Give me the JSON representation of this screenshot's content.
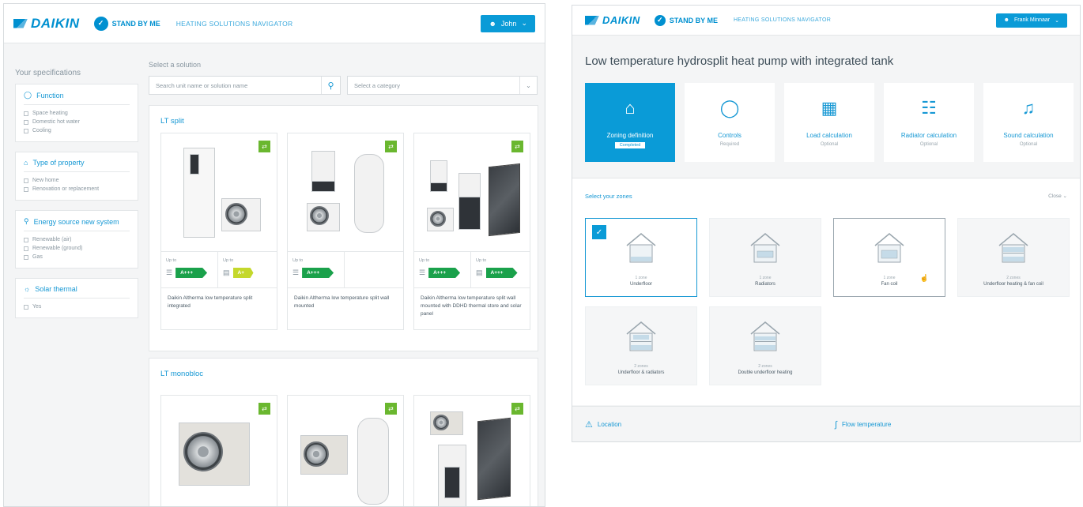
{
  "left": {
    "brand": "DAIKIN",
    "standby": "STAND BY ME",
    "app_name": "HEATING SOLUTIONS NAVIGATOR",
    "user": "John",
    "specs_title": "Your specifications",
    "filters": [
      {
        "title": "Function",
        "options": [
          "Space heating",
          "Domestic hot water",
          "Cooling"
        ]
      },
      {
        "title": "Type of property",
        "options": [
          "New home",
          "Renovation or replacement"
        ]
      },
      {
        "title": "Energy source new system",
        "options": [
          "Renewable (air)",
          "Renewable (ground)",
          "Gas"
        ]
      },
      {
        "title": "Solar thermal",
        "options": [
          "Yes"
        ]
      }
    ],
    "select_label": "Select a solution",
    "search_placeholder": "Search unit name or solution name",
    "category_placeholder": "Select a category",
    "groups": [
      {
        "title": "LT split",
        "cards": [
          {
            "up_to": "Up to",
            "ratings": [
              "A+++",
              "A+"
            ],
            "desc": "Daikin Altherma low temperature split integrated"
          },
          {
            "up_to": "Up to",
            "ratings": [
              "A+++"
            ],
            "desc": "Daikin Altherma low temperature split wall mounted"
          },
          {
            "up_to": "Up to",
            "ratings": [
              "A+++",
              "A+++"
            ],
            "desc": "Daikin Altherma low temperature split wall mounted with DDHD thermal store and solar panel"
          }
        ]
      },
      {
        "title": "LT monobloc",
        "cards": []
      }
    ]
  },
  "right": {
    "brand": "DAIKIN",
    "standby": "STAND BY ME",
    "app_name": "HEATING SOLUTIONS NAVIGATOR",
    "user": "Frank Minnaar",
    "title": "Low temperature hydrosplit heat pump with integrated tank",
    "tiles": [
      {
        "label": "Zoning definition",
        "sub": "Completed",
        "icon": "house-zones-icon"
      },
      {
        "label": "Controls",
        "sub": "Required",
        "icon": "thermometer-icon"
      },
      {
        "label": "Load calculation",
        "sub": "Optional",
        "icon": "calculator-icon"
      },
      {
        "label": "Radiator calculation",
        "sub": "Optional",
        "icon": "radiator-icon"
      },
      {
        "label": "Sound calculation",
        "sub": "Optional",
        "icon": "speaker-icon"
      }
    ],
    "zones_title": "Select your zones",
    "zones_close": "Close",
    "zones": [
      {
        "count": "1 zone",
        "name": "Underfloor"
      },
      {
        "count": "1 zone",
        "name": "Radiators"
      },
      {
        "count": "1 zone",
        "name": "Fan coil"
      },
      {
        "count": "2 zones",
        "name": "Underfloor heating & fan coil"
      },
      {
        "count": "2 zones",
        "name": "Underfloor & radiators"
      },
      {
        "count": "2 zones",
        "name": "Double underfloor heating"
      }
    ],
    "footer": {
      "location": "Location",
      "flow": "Flow temperature"
    }
  }
}
